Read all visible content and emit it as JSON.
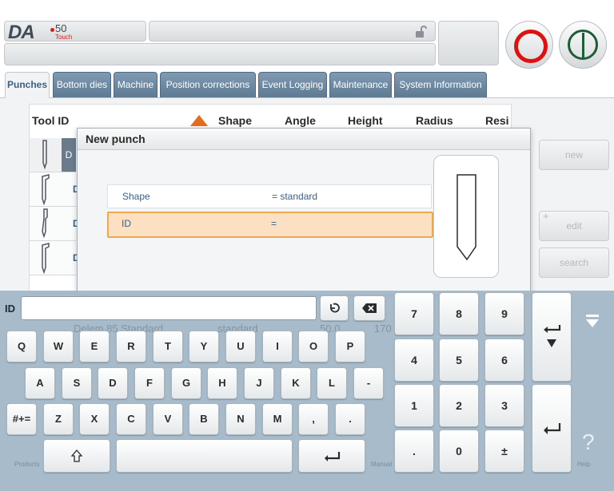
{
  "header": {
    "logo_text": "DA",
    "logo_model": "50",
    "logo_sub": "Touch",
    "lock_icon": "lock-open-icon",
    "stop_button_color": "#e01010",
    "start_button_color": "#1e5c38"
  },
  "tabs": [
    {
      "label": "Punches",
      "active": true
    },
    {
      "label": "Bottom dies"
    },
    {
      "label": "Machine"
    },
    {
      "label": "Position corrections"
    },
    {
      "label": "Event Logging"
    },
    {
      "label": "Maintenance"
    },
    {
      "label": "System Information"
    }
  ],
  "table": {
    "columns": [
      "Tool ID",
      "Shape",
      "Angle",
      "Height",
      "Radius",
      "Resi"
    ],
    "row_letter": "D",
    "faded_rows": [
      {
        "name": "Delem 85 Standard",
        "shape": "standard",
        "value": "50.0",
        "extra": "170"
      }
    ]
  },
  "side_buttons": {
    "new": "new",
    "edit": "edit",
    "search": "search"
  },
  "dialog": {
    "title": "New punch",
    "fields": [
      {
        "label": "Shape",
        "value": "= standard"
      },
      {
        "label": "ID",
        "value": "="
      }
    ]
  },
  "keyboard": {
    "input_label": "ID",
    "input_value": "",
    "row1": [
      "Q",
      "W",
      "E",
      "R",
      "T",
      "Y",
      "U",
      "I",
      "O",
      "P"
    ],
    "row2": [
      "A",
      "S",
      "D",
      "F",
      "G",
      "H",
      "J",
      "K",
      "L",
      "-"
    ],
    "row3": [
      "Z",
      "X",
      "C",
      "V",
      "B",
      "N",
      "M",
      ",",
      "."
    ],
    "symbols_key": "#+=",
    "numpad": [
      "7",
      "8",
      "9",
      "4",
      "5",
      "6",
      "1",
      "2",
      "3",
      ".",
      "0",
      "±"
    ],
    "help_label": "?",
    "bottom_faded_left": "Products",
    "bottom_faded_mid": "Manual",
    "bottom_faded_right": "Help"
  },
  "colors": {
    "accent_blue": "#3a5f88",
    "highlight_orange": "#f0a64a",
    "keyboard_bg": "#a4b9c9"
  }
}
